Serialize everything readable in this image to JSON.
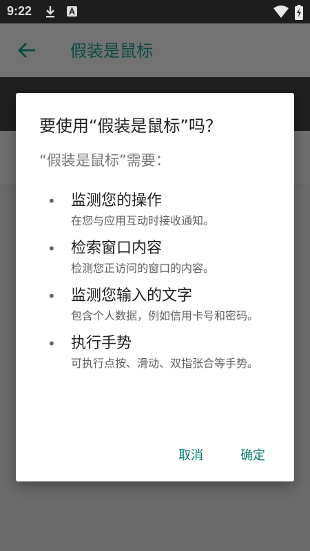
{
  "status_bar": {
    "time": "9:22",
    "icons": [
      "download-icon",
      "font-icon",
      "wifi-icon",
      "battery-charging-icon"
    ]
  },
  "app_bar": {
    "title": "假装是鼠标",
    "back_icon": "arrow-back-icon"
  },
  "dialog": {
    "title": "要使用“假装是鼠标”吗？",
    "subtitle": "“假装是鼠标”需要：",
    "permissions": [
      {
        "title": "监测您的操作",
        "description": "在您与应用互动时接收通知。"
      },
      {
        "title": "检索窗口内容",
        "description": "检测您正访问的窗口的内容。"
      },
      {
        "title": "监测您输入的文字",
        "description": "包含个人数据，例如信用卡号和密码。"
      },
      {
        "title": "执行手势",
        "description": "可执行点按、滑动、双指张合等手势。"
      }
    ],
    "cancel_label": "取消",
    "ok_label": "确定"
  },
  "colors": {
    "accent": "#00796b",
    "scrim": "#6b6b6b",
    "app_title": "#0b4a44"
  }
}
